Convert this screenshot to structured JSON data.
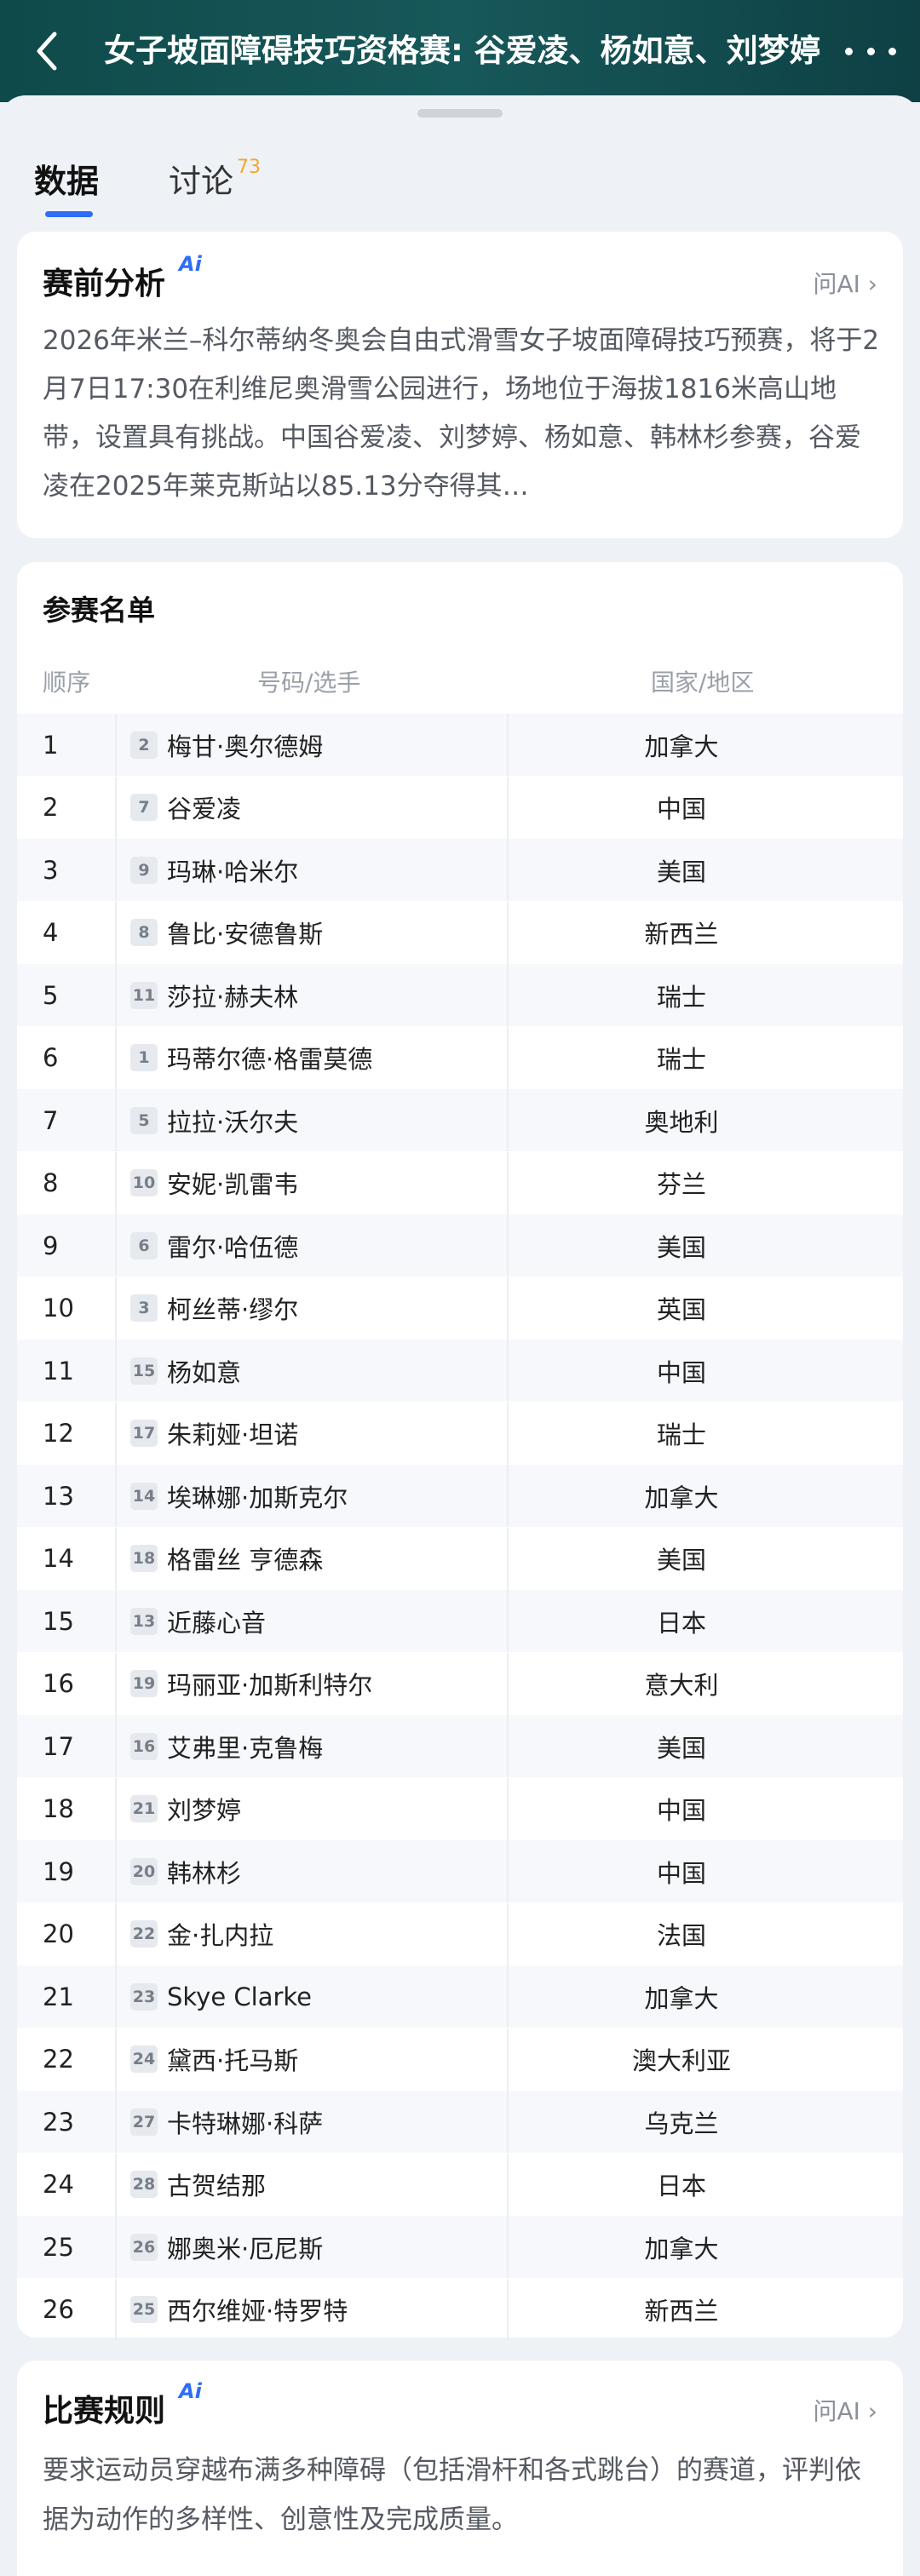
{
  "header": {
    "title": "女子坡面障碍技巧资格赛: 谷爱凌、杨如意、刘梦婷",
    "back_icon": "chevron-left-icon",
    "more_icon": "more-dots-icon"
  },
  "tabs": [
    {
      "label": "数据",
      "active": true
    },
    {
      "label": "讨论",
      "count": "73"
    }
  ],
  "analysis": {
    "title": "赛前分析",
    "ai_badge": "Ai",
    "ask_ai": "问AI",
    "body": "2026年米兰–科尔蒂纳冬奥会自由式滑雪女子坡面障碍技巧预赛，将于2月7日17:30在利维尼奥滑雪公园进行，场地位于海拔1816米高山地带，设置具有挑战。中国谷爱凌、刘梦婷、杨如意、韩林杉参赛，谷爱凌在2025年莱克斯站以85.13分夺得其…"
  },
  "roster": {
    "title": "参赛名单",
    "columns": {
      "rank": "顺序",
      "player": "号码/选手",
      "country": "国家/地区"
    },
    "rows": [
      {
        "rank": "1",
        "bib": "2",
        "name": "梅甘·奥尔德姆",
        "country": "加拿大"
      },
      {
        "rank": "2",
        "bib": "7",
        "name": "谷爱凌",
        "country": "中国"
      },
      {
        "rank": "3",
        "bib": "9",
        "name": "玛琳·哈米尔",
        "country": "美国"
      },
      {
        "rank": "4",
        "bib": "8",
        "name": "鲁比·安德鲁斯",
        "country": "新西兰"
      },
      {
        "rank": "5",
        "bib": "11",
        "name": "莎拉·赫夫林",
        "country": "瑞士"
      },
      {
        "rank": "6",
        "bib": "1",
        "name": "玛蒂尔德·格雷莫德",
        "country": "瑞士"
      },
      {
        "rank": "7",
        "bib": "5",
        "name": "拉拉·沃尔夫",
        "country": "奥地利"
      },
      {
        "rank": "8",
        "bib": "10",
        "name": "安妮·凯雷韦",
        "country": "芬兰"
      },
      {
        "rank": "9",
        "bib": "6",
        "name": "雷尔·哈伍德",
        "country": "美国"
      },
      {
        "rank": "10",
        "bib": "3",
        "name": "柯丝蒂·缪尔",
        "country": "英国"
      },
      {
        "rank": "11",
        "bib": "15",
        "name": "杨如意",
        "country": "中国"
      },
      {
        "rank": "12",
        "bib": "17",
        "name": "朱莉娅·坦诺",
        "country": "瑞士"
      },
      {
        "rank": "13",
        "bib": "14",
        "name": "埃琳娜·加斯克尔",
        "country": "加拿大"
      },
      {
        "rank": "14",
        "bib": "18",
        "name": "格雷丝 亨德森",
        "country": "美国"
      },
      {
        "rank": "15",
        "bib": "13",
        "name": "近藤心音",
        "country": "日本"
      },
      {
        "rank": "16",
        "bib": "19",
        "name": "玛丽亚·加斯利特尔",
        "country": "意大利"
      },
      {
        "rank": "17",
        "bib": "16",
        "name": "艾弗里·克鲁梅",
        "country": "美国"
      },
      {
        "rank": "18",
        "bib": "21",
        "name": "刘梦婷",
        "country": "中国"
      },
      {
        "rank": "19",
        "bib": "20",
        "name": "韩林杉",
        "country": "中国"
      },
      {
        "rank": "20",
        "bib": "22",
        "name": "金·扎内拉",
        "country": "法国"
      },
      {
        "rank": "21",
        "bib": "23",
        "name": "Skye Clarke",
        "country": "加拿大"
      },
      {
        "rank": "22",
        "bib": "24",
        "name": "黛西·托马斯",
        "country": "澳大利亚"
      },
      {
        "rank": "23",
        "bib": "27",
        "name": "卡特琳娜·科萨",
        "country": "乌克兰"
      },
      {
        "rank": "24",
        "bib": "28",
        "name": "古贺结那",
        "country": "日本"
      },
      {
        "rank": "25",
        "bib": "26",
        "name": "娜奥米·厄尼斯",
        "country": "加拿大"
      },
      {
        "rank": "26",
        "bib": "25",
        "name": "西尔维娅·特罗特",
        "country": "新西兰"
      }
    ]
  },
  "rules": {
    "title": "比赛规则",
    "ai_badge": "Ai",
    "ask_ai": "问AI",
    "body": "要求运动员穿越布满多种障碍（包括滑杆和各式跳台）的赛道，评判依据为动作的多样性、创意性及完成质量。"
  },
  "colors": {
    "accent": "#2f6df6",
    "header_bg": "#17585a",
    "tab_count": "#f4a72a"
  }
}
